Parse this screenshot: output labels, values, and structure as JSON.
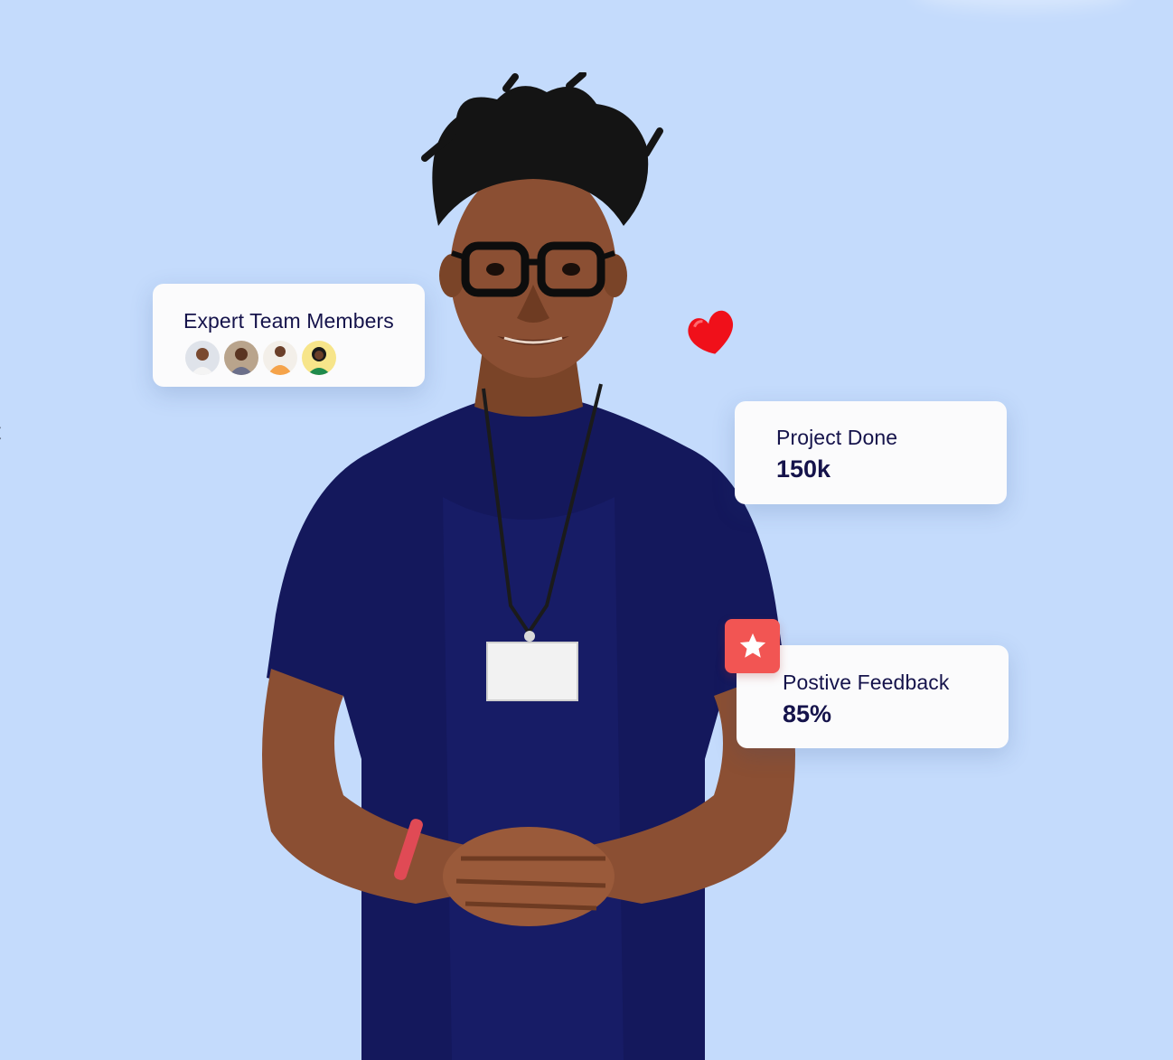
{
  "edge_fragment": "t",
  "cards": {
    "team": {
      "title": "Expert Team Members",
      "avatar_count": 4
    },
    "projects": {
      "title": "Project Done",
      "value": "150k"
    },
    "feedback": {
      "title": "Postive Feedback",
      "value": "85%"
    }
  },
  "icons": {
    "heart": "heart-icon",
    "star": "star-icon"
  },
  "colors": {
    "background": "#c4dbfc",
    "card": "#fbfbfc",
    "text": "#15134b",
    "accent_red": "#f25553",
    "heart": "#f0101a",
    "shirt": "#14185c"
  }
}
